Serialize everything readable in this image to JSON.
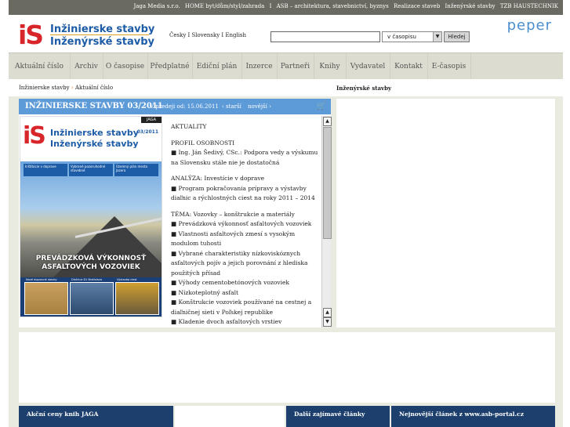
{
  "topbar": {
    "links": [
      "Jaga Media s.r.o.",
      "HOME byt/dům/styl/zahrada",
      "I",
      "ASB – architektura, stavebnictví, byznys",
      "Realizace staveb",
      "Inženýrské stavby",
      "TZB HAUSTECHNIK"
    ]
  },
  "header": {
    "logo": {
      "mark": "iS",
      "line1": "Inžinierske stavby",
      "line2": "Inženýrské stavby"
    },
    "languages": "Česky I Slovensky I English",
    "search": {
      "value": "",
      "select_value": "v časopisu",
      "button": "Hledej"
    },
    "partner_logo": "peper"
  },
  "nav": {
    "items": [
      "Aktuální číslo",
      "Archiv",
      "O časopise",
      "Předplatné",
      "Ediční plán",
      "Inzerce",
      "Partneři",
      "Knihy",
      "Vydavatel",
      "Kontakt",
      "E-časopis"
    ]
  },
  "breadcrumb": {
    "home": "Inžinierske stavby",
    "separator": "›",
    "current": "Aktuální číslo"
  },
  "right_column": {
    "title": "Inženýrské stavby"
  },
  "issue": {
    "title": "INŽINIERSKE STAVBY 03/2011",
    "date": "V predeji od: 15.06.2011",
    "prev": "starší",
    "next": "novější",
    "cover": {
      "badge": "JAGA",
      "issue_label": "03/2011",
      "headline1": "PREVÁDZKOVÁ VÝKONNOSŤ",
      "headline2": "ASFALTOVÝCH VOZOVIEK",
      "tabs": [
        "Inštitúcie v doprave",
        "Vybrané pozoruhodné stavebné",
        "Územný plán mesta Jazera"
      ],
      "thumbs": [
        "Nové dopravné stavby",
        "Diaľnica D1 Bratislava",
        "Výstavba ciest"
      ]
    },
    "toc": [
      "AKTUALITY",
      "",
      "PROFIL OSOBNOSTI",
      "■ Ing. Ján Šedivý, CSc.: Podpora vedy a výskumu na Slovensku stále nie je dostatočná",
      "",
      "ANALÝZA: Investície v doprave",
      "■ Program pokračovania prípravy a výstavby diaľnic a rýchlostných ciest na roky 2011 – 2014",
      "",
      "TÉMA: Vozovky – konštrukcie a materiály",
      "■ Prevádzková výkonnosť asfaltových vozoviek",
      "■ Vlastnosti asfaltových zmesí s vysokým modulom tuhosti",
      "■ Vybrané charakteristiky nízkoviskóznych asfaltových pojív a jejich porovnání z hlediska použitých přísad",
      "■ Výhody cementobetónových vozoviek",
      "■ Nízkoteplotný asfalt",
      "■ Konštrukcie vozoviek používané na cestnej a diaľničnej sieti v Poľskej republike",
      "■ Kladenie dvoch asfaltových vrstiev"
    ]
  },
  "bottom": {
    "books": "Akční ceny knih JAGA",
    "more_articles": "Další zajímavé články",
    "latest": "Nejnovější článek z www.asb-portal.cz"
  }
}
